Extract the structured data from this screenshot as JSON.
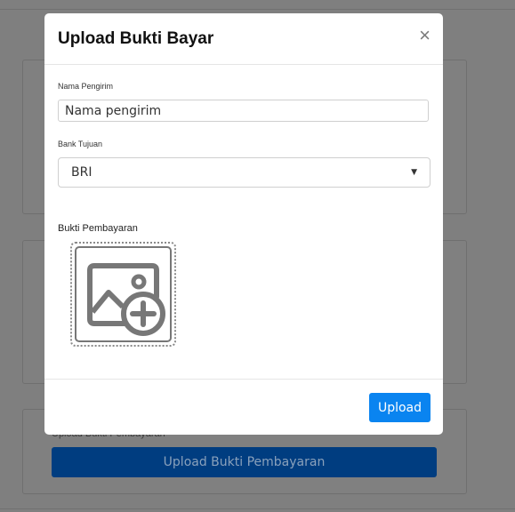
{
  "background": {
    "upload_label": "Upload Bukti Pembayaran",
    "upload_button": "Upload Bukti Pembayaran"
  },
  "modal": {
    "title": "Upload Bukti Bayar",
    "close_symbol": "×",
    "sender": {
      "label": "Nama Pengirim",
      "value": "Nama pengirim"
    },
    "bank": {
      "label": "Bank Tujuan",
      "selected": "BRI",
      "caret": "▼"
    },
    "proof": {
      "label": "Bukti Pembayaran",
      "icon": "image-add-icon"
    },
    "submit_label": "Upload"
  },
  "colors": {
    "overlay": "#7f7f7f",
    "primary": "#0a84f0",
    "background_button": "#003d80"
  }
}
